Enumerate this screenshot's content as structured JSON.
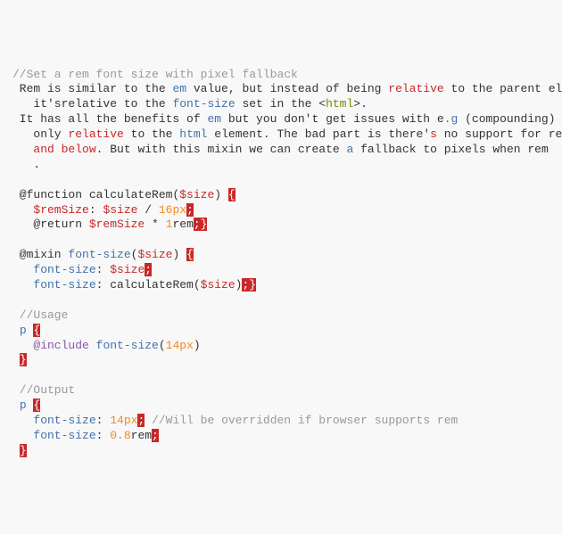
{
  "tokens": [
    {
      "cls": "c",
      "t": "//Set a rem font size with pixel fallback"
    },
    {
      "cls": "",
      "t": "\n"
    },
    {
      "cls": "",
      "t": " Rem is similar to the "
    },
    {
      "cls": "bl",
      "t": "em"
    },
    {
      "cls": "",
      "t": " value, but instead of being "
    },
    {
      "cls": "kw",
      "t": "relative"
    },
    {
      "cls": "",
      "t": " to the parent element,"
    },
    {
      "cls": "",
      "t": "\n"
    },
    {
      "cls": "",
      "t": "   it'srelative to the "
    },
    {
      "cls": "bl",
      "t": "font-size"
    },
    {
      "cls": "",
      "t": " set in the <"
    },
    {
      "cls": "gr",
      "t": "html"
    },
    {
      "cls": "",
      "t": ">."
    },
    {
      "cls": "",
      "t": "\n"
    },
    {
      "cls": "",
      "t": " It has all the benefits of "
    },
    {
      "cls": "bl",
      "t": "em"
    },
    {
      "cls": "",
      "t": " but you don't get issues with e"
    },
    {
      "cls": "bl",
      "t": ".g"
    },
    {
      "cls": "",
      "t": " (compounding) since"
    },
    {
      "cls": "",
      "t": "\n"
    },
    {
      "cls": "",
      "t": "   only "
    },
    {
      "cls": "kw",
      "t": "relative"
    },
    {
      "cls": "",
      "t": " to the "
    },
    {
      "cls": "bl",
      "t": "html"
    },
    {
      "cls": "",
      "t": " element. The bad part is there'"
    },
    {
      "cls": "kw",
      "t": "s"
    },
    {
      "cls": "",
      "t": " no support for rem"
    },
    {
      "cls": "",
      "t": "\n"
    },
    {
      "cls": "",
      "t": "   "
    },
    {
      "cls": "kw",
      "t": "and"
    },
    {
      "cls": "",
      "t": " "
    },
    {
      "cls": "kw",
      "t": "below"
    },
    {
      "cls": "",
      "t": ". But with this mixin we can create "
    },
    {
      "cls": "bl",
      "t": "a"
    },
    {
      "cls": "",
      "t": " fallback to pixels when rem "
    },
    {
      "cls": "",
      "t": "\n"
    },
    {
      "cls": "",
      "t": "   ."
    },
    {
      "cls": "",
      "t": "\n"
    },
    {
      "cls": "",
      "t": "\n"
    },
    {
      "cls": "",
      "t": " @function calculateRem("
    },
    {
      "cls": "kw",
      "t": "$size"
    },
    {
      "cls": "",
      "t": ") "
    },
    {
      "cls": "hl",
      "t": "{"
    },
    {
      "cls": "",
      "t": "\n"
    },
    {
      "cls": "",
      "t": "   "
    },
    {
      "cls": "kw",
      "t": "$remSize"
    },
    {
      "cls": "",
      "t": ": "
    },
    {
      "cls": "kw",
      "t": "$size"
    },
    {
      "cls": "",
      "t": " / "
    },
    {
      "cls": "or",
      "t": "16px"
    },
    {
      "cls": "hl",
      "t": ";"
    },
    {
      "cls": "",
      "t": "\n"
    },
    {
      "cls": "",
      "t": "   @return "
    },
    {
      "cls": "kw",
      "t": "$remSize"
    },
    {
      "cls": "",
      "t": " * "
    },
    {
      "cls": "or",
      "t": "1"
    },
    {
      "cls": "",
      "t": "rem"
    },
    {
      "cls": "hl",
      "t": ";}"
    },
    {
      "cls": "",
      "t": "\n"
    },
    {
      "cls": "",
      "t": "\n"
    },
    {
      "cls": "",
      "t": " @mixin "
    },
    {
      "cls": "bl",
      "t": "font-size"
    },
    {
      "cls": "",
      "t": "("
    },
    {
      "cls": "kw",
      "t": "$size"
    },
    {
      "cls": "",
      "t": ") "
    },
    {
      "cls": "hl",
      "t": "{"
    },
    {
      "cls": "",
      "t": "\n"
    },
    {
      "cls": "",
      "t": "   "
    },
    {
      "cls": "bl",
      "t": "font-size"
    },
    {
      "cls": "",
      "t": ": "
    },
    {
      "cls": "kw",
      "t": "$size"
    },
    {
      "cls": "hl",
      "t": ";"
    },
    {
      "cls": "",
      "t": "\n"
    },
    {
      "cls": "",
      "t": "   "
    },
    {
      "cls": "bl",
      "t": "font-size"
    },
    {
      "cls": "",
      "t": ": calculateRem("
    },
    {
      "cls": "kw",
      "t": "$size"
    },
    {
      "cls": "",
      "t": ")"
    },
    {
      "cls": "hl",
      "t": ";}"
    },
    {
      "cls": "",
      "t": "\n"
    },
    {
      "cls": "",
      "t": "\n"
    },
    {
      "cls": "c",
      "t": " //Usage"
    },
    {
      "cls": "",
      "t": "\n"
    },
    {
      "cls": "",
      "t": " "
    },
    {
      "cls": "bl",
      "t": "p"
    },
    {
      "cls": "",
      "t": " "
    },
    {
      "cls": "hl",
      "t": "{"
    },
    {
      "cls": "",
      "t": "\n"
    },
    {
      "cls": "",
      "t": "   "
    },
    {
      "cls": "pu",
      "t": "@include"
    },
    {
      "cls": "",
      "t": " "
    },
    {
      "cls": "bl",
      "t": "font-size"
    },
    {
      "cls": "",
      "t": "("
    },
    {
      "cls": "or",
      "t": "14px"
    },
    {
      "cls": "",
      "t": ")"
    },
    {
      "cls": "",
      "t": "\n"
    },
    {
      "cls": "",
      "t": " "
    },
    {
      "cls": "hl",
      "t": "}"
    },
    {
      "cls": "",
      "t": "\n"
    },
    {
      "cls": "",
      "t": "\n"
    },
    {
      "cls": "c",
      "t": " //Output"
    },
    {
      "cls": "",
      "t": "\n"
    },
    {
      "cls": "",
      "t": " "
    },
    {
      "cls": "bl",
      "t": "p"
    },
    {
      "cls": "",
      "t": " "
    },
    {
      "cls": "hl",
      "t": "{"
    },
    {
      "cls": "",
      "t": "\n"
    },
    {
      "cls": "",
      "t": "   "
    },
    {
      "cls": "bl",
      "t": "font-size"
    },
    {
      "cls": "",
      "t": ": "
    },
    {
      "cls": "or",
      "t": "14px"
    },
    {
      "cls": "hl",
      "t": ";"
    },
    {
      "cls": "",
      "t": " "
    },
    {
      "cls": "c",
      "t": "//Will be overridden if browser supports rem"
    },
    {
      "cls": "",
      "t": "\n"
    },
    {
      "cls": "",
      "t": "   "
    },
    {
      "cls": "bl",
      "t": "font-size"
    },
    {
      "cls": "",
      "t": ": "
    },
    {
      "cls": "or",
      "t": "0.8"
    },
    {
      "cls": "",
      "t": "rem"
    },
    {
      "cls": "hl",
      "t": ";"
    },
    {
      "cls": "",
      "t": "\n"
    },
    {
      "cls": "",
      "t": " "
    },
    {
      "cls": "hl",
      "t": "}"
    },
    {
      "cls": "",
      "t": "\n"
    }
  ]
}
